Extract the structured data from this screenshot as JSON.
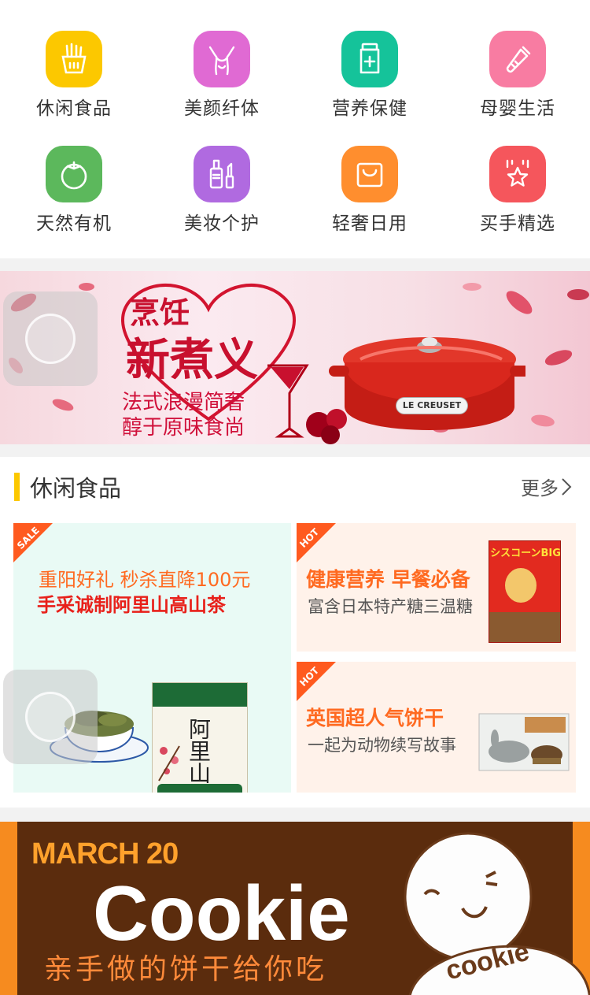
{
  "categories": [
    {
      "label": "休闲食品",
      "icon": "fries-icon",
      "color": "#fcc800"
    },
    {
      "label": "美颜纤体",
      "icon": "body-icon",
      "color": "#e06ad3"
    },
    {
      "label": "营养保健",
      "icon": "medicine-bottle-icon",
      "color": "#15c39a"
    },
    {
      "label": "母婴生活",
      "icon": "baby-bottle-icon",
      "color": "#f87ca2"
    },
    {
      "label": "天然有机",
      "icon": "tomato-icon",
      "color": "#5cb85c"
    },
    {
      "label": "美妆个护",
      "icon": "cosmetics-icon",
      "color": "#b06ae0"
    },
    {
      "label": "轻奢日用",
      "icon": "bag-icon",
      "color": "#ff8e2e"
    },
    {
      "label": "买手精选",
      "icon": "star-badge-icon",
      "color": "#f5565c"
    }
  ],
  "banner1": {
    "line1": "烹饪",
    "line2": "新煮义",
    "line3": "法式浪漫简奢",
    "line4": "醇于原味食尚",
    "brand": "LE CREUSET"
  },
  "section": {
    "title": "休闲食品",
    "more": "更多",
    "big_card": {
      "tag": "SALE",
      "line1": "重阳好礼 秒杀直降100元",
      "line2": "手采诚制阿里山高山茶",
      "product_text": "阿里山"
    },
    "small_card1": {
      "tag": "HOT",
      "line1": "健康营养 早餐必备",
      "line2": "富含日本特产糖三温糖",
      "product_text": "シスコーンBIG"
    },
    "small_card2": {
      "tag": "HOT",
      "line1": "英国超人气饼干",
      "line2": "一起为动物续写故事"
    }
  },
  "banner2": {
    "date": "MARCH 20",
    "title": "Cookie",
    "subtitle": "亲手做的饼干给你吃",
    "mascot_text": "cookie"
  }
}
